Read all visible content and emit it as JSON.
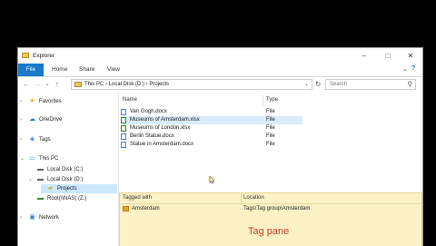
{
  "window": {
    "title": "Explorer",
    "controls": {
      "minimize": "–",
      "maximize": "□",
      "close": "✕"
    }
  },
  "ribbon": {
    "tabs": [
      "File",
      "Home",
      "Share",
      "View"
    ],
    "expand_glyph": "⌄",
    "help_glyph": "?"
  },
  "address": {
    "path": "This PC  ›  Local Disk (D:)  ›  Projects",
    "back_glyph": "←",
    "forward_glyph": "→",
    "recent_glyph": "⌄",
    "up_glyph": "↑",
    "dropdown_glyph": "⌄",
    "refresh_glyph": "↻"
  },
  "search": {
    "placeholder": "Search",
    "icon_glyph": "⚲"
  },
  "nav": {
    "favorites": "Favorites",
    "onedrive": "OneDrive",
    "tags": "Tags",
    "thispc": "This PC",
    "localc": "Local Disk (C:)",
    "locald": "Local Disk (D:)",
    "projects": "Projects",
    "nas": "Root(\\\\NAS) (Z:)",
    "network": "Network"
  },
  "files": {
    "columns": {
      "name": "Name",
      "type": "Type"
    },
    "rows": [
      {
        "name": "Van Gogh.docx",
        "type": "File"
      },
      {
        "name": "Museums of Amsterdam.xlsx",
        "type": "File"
      },
      {
        "name": "Museums of London.xlsx",
        "type": "File"
      },
      {
        "name": "Berlin Statue.docx",
        "type": "File"
      },
      {
        "name": "Statue in Amsterdam.docx",
        "type": "File"
      }
    ]
  },
  "tagpane": {
    "tagged_with_header": "Tagged with",
    "location_header": "Location",
    "tag": "Amsterdam",
    "location": "Tags\\Tag group\\Amsterdam",
    "caption": "Tag pane"
  },
  "colors": {
    "accent": "#1979ca",
    "selection": "#cce8ff",
    "tagpane_bg": "#fdf2c5",
    "caption": "#c0392b"
  }
}
